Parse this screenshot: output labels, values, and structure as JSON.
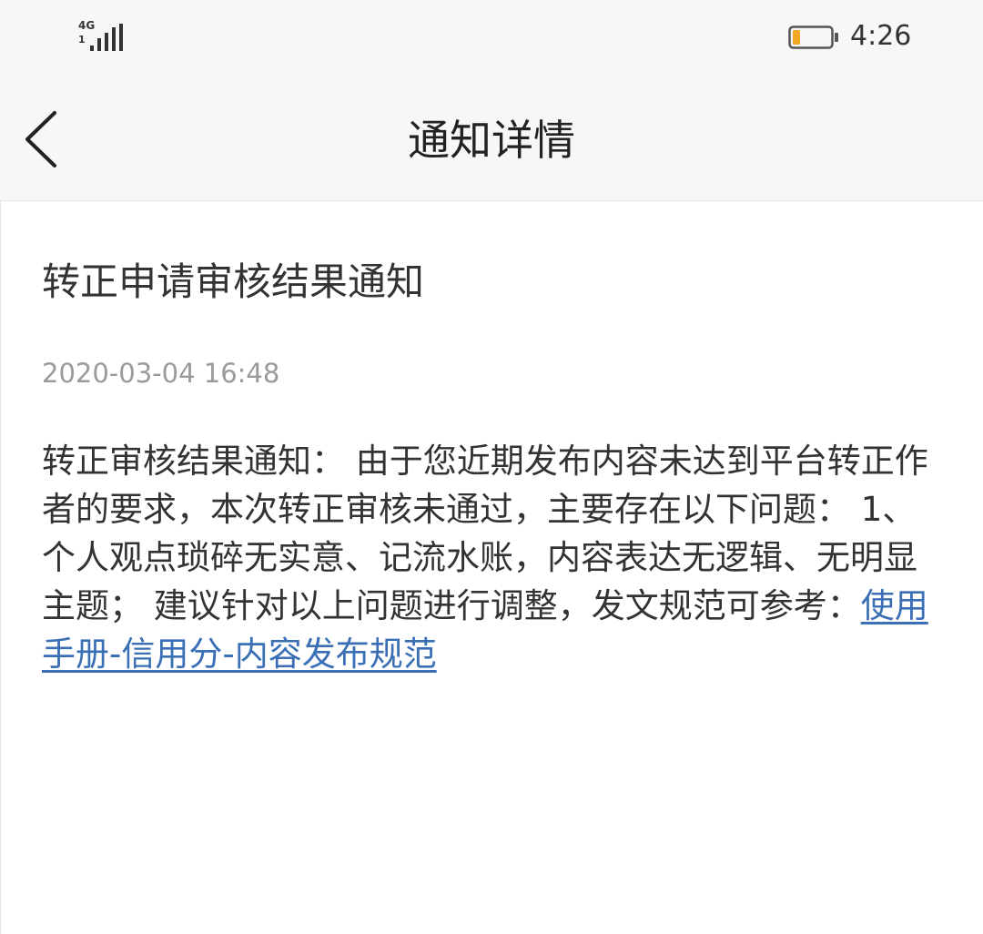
{
  "status_bar": {
    "network": "4G",
    "network_sub": "1",
    "signal_level": 4,
    "battery_level": 0.2,
    "battery_color": "#f5a623",
    "time": "4:26"
  },
  "nav": {
    "back_icon": "chevron-left-icon",
    "title": "通知详情"
  },
  "notice": {
    "title": "转正申请审核结果通知",
    "time": "2020-03-04 16:48",
    "body": "转正审核结果通知： 由于您近期发布内容未达到平台转正作者的要求，本次转正审核未通过，主要存在以下问题： 1、个人观点琐碎无实意、记流水账，内容表达无逻辑、无明显主题； 建议针对以上问题进行调整，发文规范可参考：",
    "link_text": "使用手册-信用分-内容发布规范",
    "link_color": "#3a6fb5"
  }
}
